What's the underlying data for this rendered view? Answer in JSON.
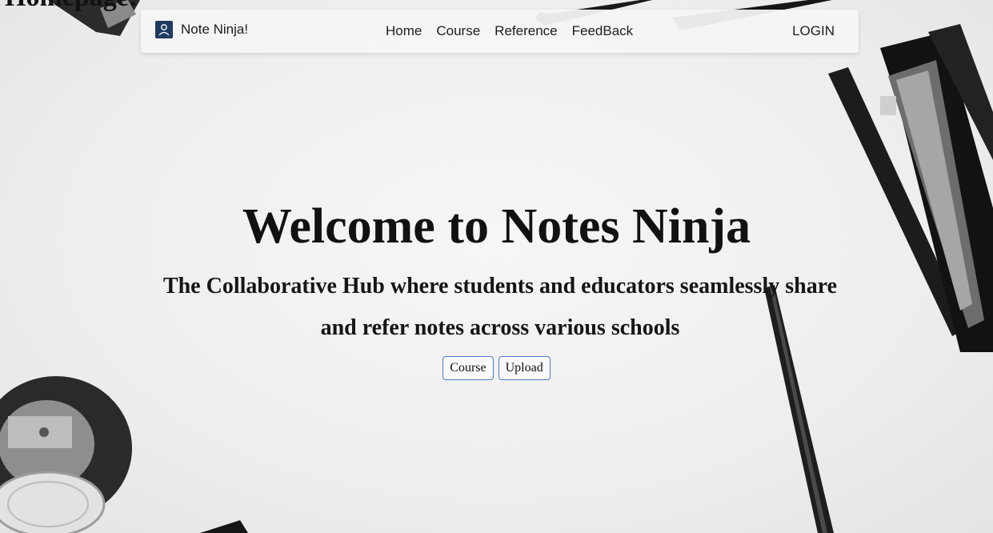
{
  "page_label": "Homepage:",
  "navbar": {
    "brand": "Note Ninja!",
    "links": [
      "Home",
      "Course",
      "Reference",
      "FeedBack"
    ],
    "login": "LOGIN"
  },
  "hero": {
    "title": "Welcome to Notes Ninja",
    "subtitle_line1": "The Collaborative Hub where students and educators seamlessly share",
    "subtitle_line2": "and refer notes across various schools",
    "buttons": [
      "Course",
      "Upload"
    ]
  },
  "colors": {
    "brand_logo_bg": "#1e3a5f",
    "button_border": "#4a7bd0"
  }
}
